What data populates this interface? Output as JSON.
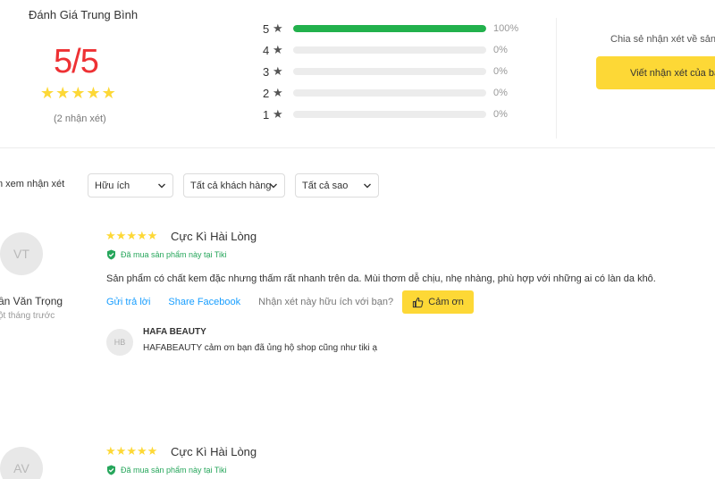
{
  "summary": {
    "title": "Đánh Giá Trung Bình",
    "score": "5/5",
    "count_text": "(2 nhận xét)",
    "distribution": [
      {
        "stars": "5",
        "percent": "100%",
        "fill": 1.0
      },
      {
        "stars": "4",
        "percent": "0%",
        "fill": 0
      },
      {
        "stars": "3",
        "percent": "0%",
        "fill": 0
      },
      {
        "stars": "2",
        "percent": "0%",
        "fill": 0
      },
      {
        "stars": "1",
        "percent": "0%",
        "fill": 0
      }
    ],
    "share_text": "Chia sẻ nhận xét về sản p",
    "write_button": "Viết nhận xét của bạ",
    "star_color": "#fdd836",
    "bar_color": "#22b14c",
    "accent_red": "#ee3134"
  },
  "filters": {
    "label": "n xem nhận xét",
    "sort": "Hữu ích",
    "customers": "Tất cả khách hàng",
    "stars": "Tất cả sao"
  },
  "reviews": [
    {
      "initials": "VT",
      "name": "ần Văn Trọng",
      "time": "ột tháng trước",
      "rating": 5,
      "title": "Cực Kì Hài Lòng",
      "verified": "Đã mua sản phẩm này tại Tiki",
      "body": "Sản phẩm có chất kem đặc nhưng thấm rất nhanh trên da. Mùi thơm dễ chịu, nhẹ nhàng, phù hợp với những ai có làn da khô.",
      "reply_link": "Gửi trả lời",
      "share_link": "Share Facebook",
      "helpful_question": "Nhận xét này hữu ích với bạn?",
      "thanks_button": "Cảm ơn",
      "reply": {
        "initials": "HB",
        "name": "HAFA BEAUTY",
        "text": "HAFABEAUTY cảm ơn bạn đã ủng hộ shop cũng như tiki ạ"
      }
    },
    {
      "initials": "AV",
      "rating": 5,
      "title": "Cực Kì Hài Lòng",
      "verified": "Đã mua sản phẩm này tại Tiki"
    }
  ]
}
